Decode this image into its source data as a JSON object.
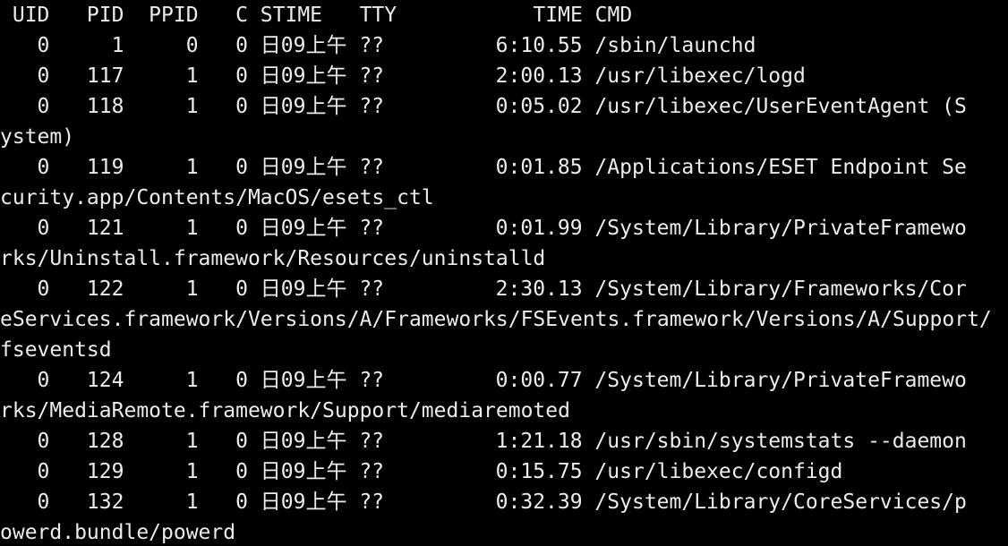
{
  "terminal": {
    "header": " UID   PID  PPID   C STIME   TTY           TIME CMD",
    "lines": [
      "   0     1     0   0 日09上午 ??         6:10.55 /sbin/launchd",
      "   0   117     1   0 日09上午 ??         2:00.13 /usr/libexec/logd",
      "   0   118     1   0 日09上午 ??         0:05.02 /usr/libexec/UserEventAgent (S",
      "ystem)",
      "   0   119     1   0 日09上午 ??         0:01.85 /Applications/ESET Endpoint Se",
      "curity.app/Contents/MacOS/esets_ctl",
      "   0   121     1   0 日09上午 ??         0:01.99 /System/Library/PrivateFramewo",
      "rks/Uninstall.framework/Resources/uninstalld",
      "   0   122     1   0 日09上午 ??         2:30.13 /System/Library/Frameworks/Cor",
      "eServices.framework/Versions/A/Frameworks/FSEvents.framework/Versions/A/Support/",
      "fseventsd",
      "   0   124     1   0 日09上午 ??         0:00.77 /System/Library/PrivateFramewo",
      "rks/MediaRemote.framework/Support/mediaremoted",
      "   0   128     1   0 日09上午 ??         1:21.18 /usr/sbin/systemstats --daemon",
      "   0   129     1   0 日09上午 ??         0:15.75 /usr/libexec/configd",
      "   0   132     1   0 日09上午 ??         0:32.39 /System/Library/CoreServices/p",
      "owerd.bundle/powerd"
    ]
  }
}
